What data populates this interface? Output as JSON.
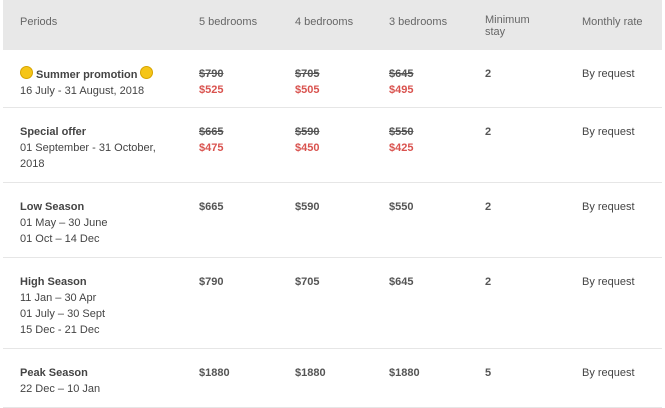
{
  "headers": {
    "periods": "Periods",
    "bed5": "5 bedrooms",
    "bed4": "4 bedrooms",
    "bed3": "3 bedrooms",
    "min_stay_line1": "Minimum",
    "min_stay_line2": "stay",
    "monthly": "Monthly rate"
  },
  "rows": [
    {
      "title": "Summer promotion",
      "dates": [
        "16 July - 31 August, 2018"
      ],
      "bed5_old": "$790",
      "bed5_new": "$525",
      "bed4_old": "$705",
      "bed4_new": "$505",
      "bed3_old": "$645",
      "bed3_new": "$495",
      "min_stay": "2",
      "monthly": "By request"
    },
    {
      "title": "Special offer",
      "dates": [
        "01 September - 31 October,",
        "2018"
      ],
      "bed5_old": "$665",
      "bed5_new": "$475",
      "bed4_old": "$590",
      "bed4_new": "$450",
      "bed3_old": "$550",
      "bed3_new": "$425",
      "min_stay": "2",
      "monthly": "By request"
    },
    {
      "title": "Low Season",
      "dates": [
        "01 May – 30 June",
        "01 Oct – 14 Dec"
      ],
      "bed5": "$665",
      "bed4": "$590",
      "bed3": "$550",
      "min_stay": "2",
      "monthly": "By request"
    },
    {
      "title": "High Season",
      "dates": [
        "11 Jan – 30 Apr",
        "01 July – 30 Sept",
        "15 Dec - 21 Dec"
      ],
      "bed5": "$790",
      "bed4": "$705",
      "bed3": "$645",
      "min_stay": "2",
      "monthly": "By request"
    },
    {
      "title": "Peak Season",
      "dates": [
        "22 Dec – 10 Jan"
      ],
      "bed5": "$1880",
      "bed4": "$1880",
      "bed3": "$1880",
      "min_stay": "5",
      "monthly": "By request"
    }
  ]
}
